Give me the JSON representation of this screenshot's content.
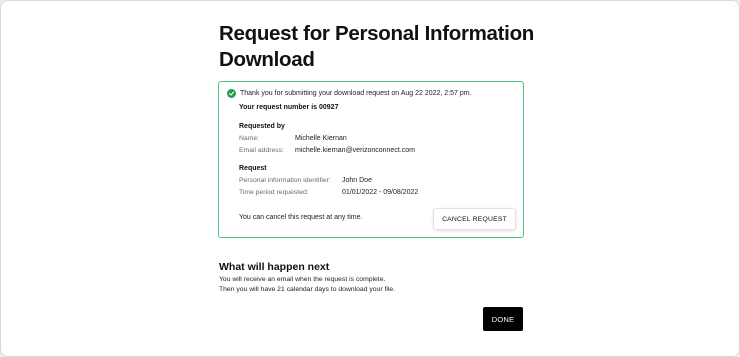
{
  "page": {
    "title": "Request for Personal Information Download"
  },
  "confirmation": {
    "message": "Thank you for submitting your download request on Aug 22 2022, 2:57 pm.",
    "request_number_text": "Your request number is 00927",
    "status_color": "#1f9d4a",
    "border_color": "#4ec57a"
  },
  "requested_by": {
    "heading": "Requested by",
    "name_label": "Name:",
    "name_value": "Michelle Kiernan",
    "email_label": "Email address:",
    "email_value": "michelle.kiernan@verizonconnect.com"
  },
  "request": {
    "heading": "Request",
    "identifier_label": "Personal information identifier:",
    "identifier_value": "John Doe",
    "period_label": "Time period requested:",
    "period_value": "01/01/2022 - 09/08/2022"
  },
  "cancel": {
    "note": "You can cancel this request at any time.",
    "button_label": "CANCEL REQUEST"
  },
  "next": {
    "heading": "What will happen next",
    "line1": "You will receive an email when the request is complete.",
    "line2": "Then you will have 21 calendar days to download your file."
  },
  "actions": {
    "done_label": "DONE"
  }
}
